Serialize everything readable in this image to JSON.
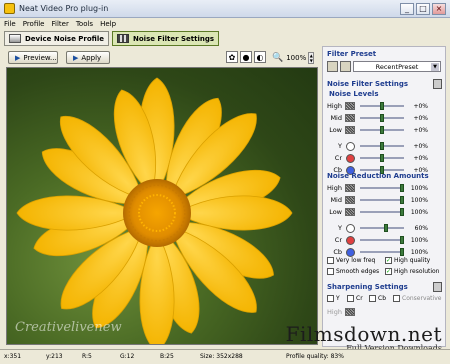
{
  "window": {
    "title": "Neat Video Pro plug-in"
  },
  "menu": [
    "File",
    "Profile",
    "Filter",
    "Tools",
    "Help"
  ],
  "tabs": {
    "device": "Device Noise Profile",
    "filter": "Noise Filter Settings"
  },
  "toolbar": {
    "preview": "Preview...",
    "apply": "Apply",
    "zoom": "100%"
  },
  "panel": {
    "filter_preset": "Filter Preset",
    "preset_value": "RecentPreset",
    "noise_filter_settings": "Noise Filter Settings",
    "noise_levels": "Noise Levels",
    "levels": [
      {
        "label": "High",
        "value": "+0%",
        "pos": 0.5
      },
      {
        "label": "Mid",
        "value": "+0%",
        "pos": 0.5
      },
      {
        "label": "Low",
        "value": "+0%",
        "pos": 0.5
      },
      {
        "label": "Y",
        "value": "+0%",
        "pos": 0.5
      },
      {
        "label": "Cr",
        "value": "+0%",
        "pos": 0.5
      },
      {
        "label": "Cb",
        "value": "+0%",
        "pos": 0.5
      }
    ],
    "noise_reduction": "Noise Reduction Amounts",
    "amounts": [
      {
        "label": "High",
        "value": "100%",
        "pos": 1.0
      },
      {
        "label": "Mid",
        "value": "100%",
        "pos": 1.0
      },
      {
        "label": "Low",
        "value": "100%",
        "pos": 1.0
      },
      {
        "label": "Y",
        "value": "60%",
        "pos": 0.6
      },
      {
        "label": "Cr",
        "value": "100%",
        "pos": 1.0
      },
      {
        "label": "Cb",
        "value": "100%",
        "pos": 1.0
      }
    ],
    "checks": {
      "very_low": "Very low freq",
      "high_quality": "High quality",
      "smooth_edges": "Smooth edges",
      "high_res": "High resolution"
    },
    "sharpening": "Sharpening Settings",
    "sharp_checks": [
      "Y",
      "Cr",
      "Cb",
      "Conservative"
    ],
    "sharp_high": "High"
  },
  "status": {
    "x": "x:351",
    "y": "y:213",
    "r": "R:5",
    "g": "G:12",
    "b": "B:25",
    "size": "Size: 352x288",
    "quality": "Profile quality: 83%"
  },
  "watermark": "Creativelivenew",
  "brand": {
    "name": "Filmsdown.net",
    "tag": "Full Version Downloads"
  }
}
